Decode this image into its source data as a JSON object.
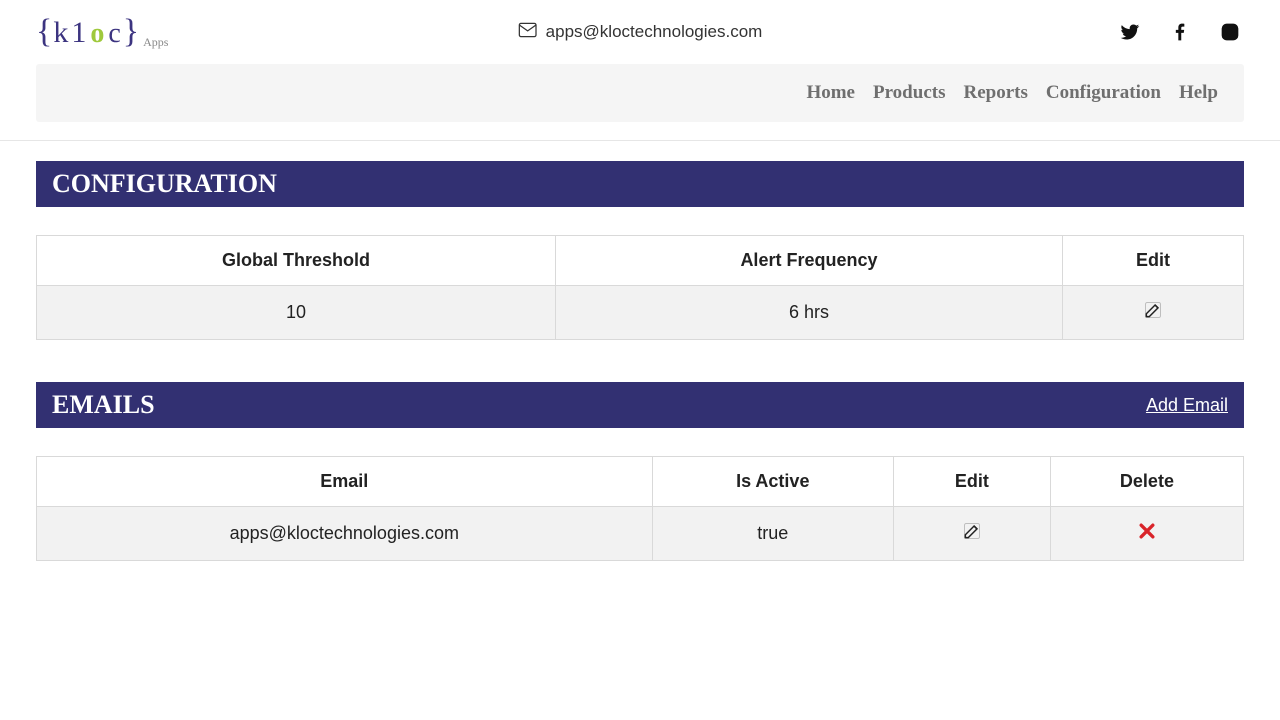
{
  "header": {
    "email": "apps@kloctechnologies.com",
    "logo_apps": "Apps"
  },
  "nav": {
    "home": "Home",
    "products": "Products",
    "reports": "Reports",
    "configuration": "Configuration",
    "help": "Help"
  },
  "sections": {
    "config_title": "CONFIGURATION",
    "emails_title": "EMAILS",
    "add_email": "Add Email"
  },
  "config_table": {
    "headers": {
      "threshold": "Global Threshold",
      "frequency": "Alert Frequency",
      "edit": "Edit"
    },
    "row": {
      "threshold": "10",
      "frequency": "6 hrs"
    }
  },
  "emails_table": {
    "headers": {
      "email": "Email",
      "active": "Is Active",
      "edit": "Edit",
      "delete": "Delete"
    },
    "row": {
      "email": "apps@kloctechnologies.com",
      "active": "true"
    }
  }
}
